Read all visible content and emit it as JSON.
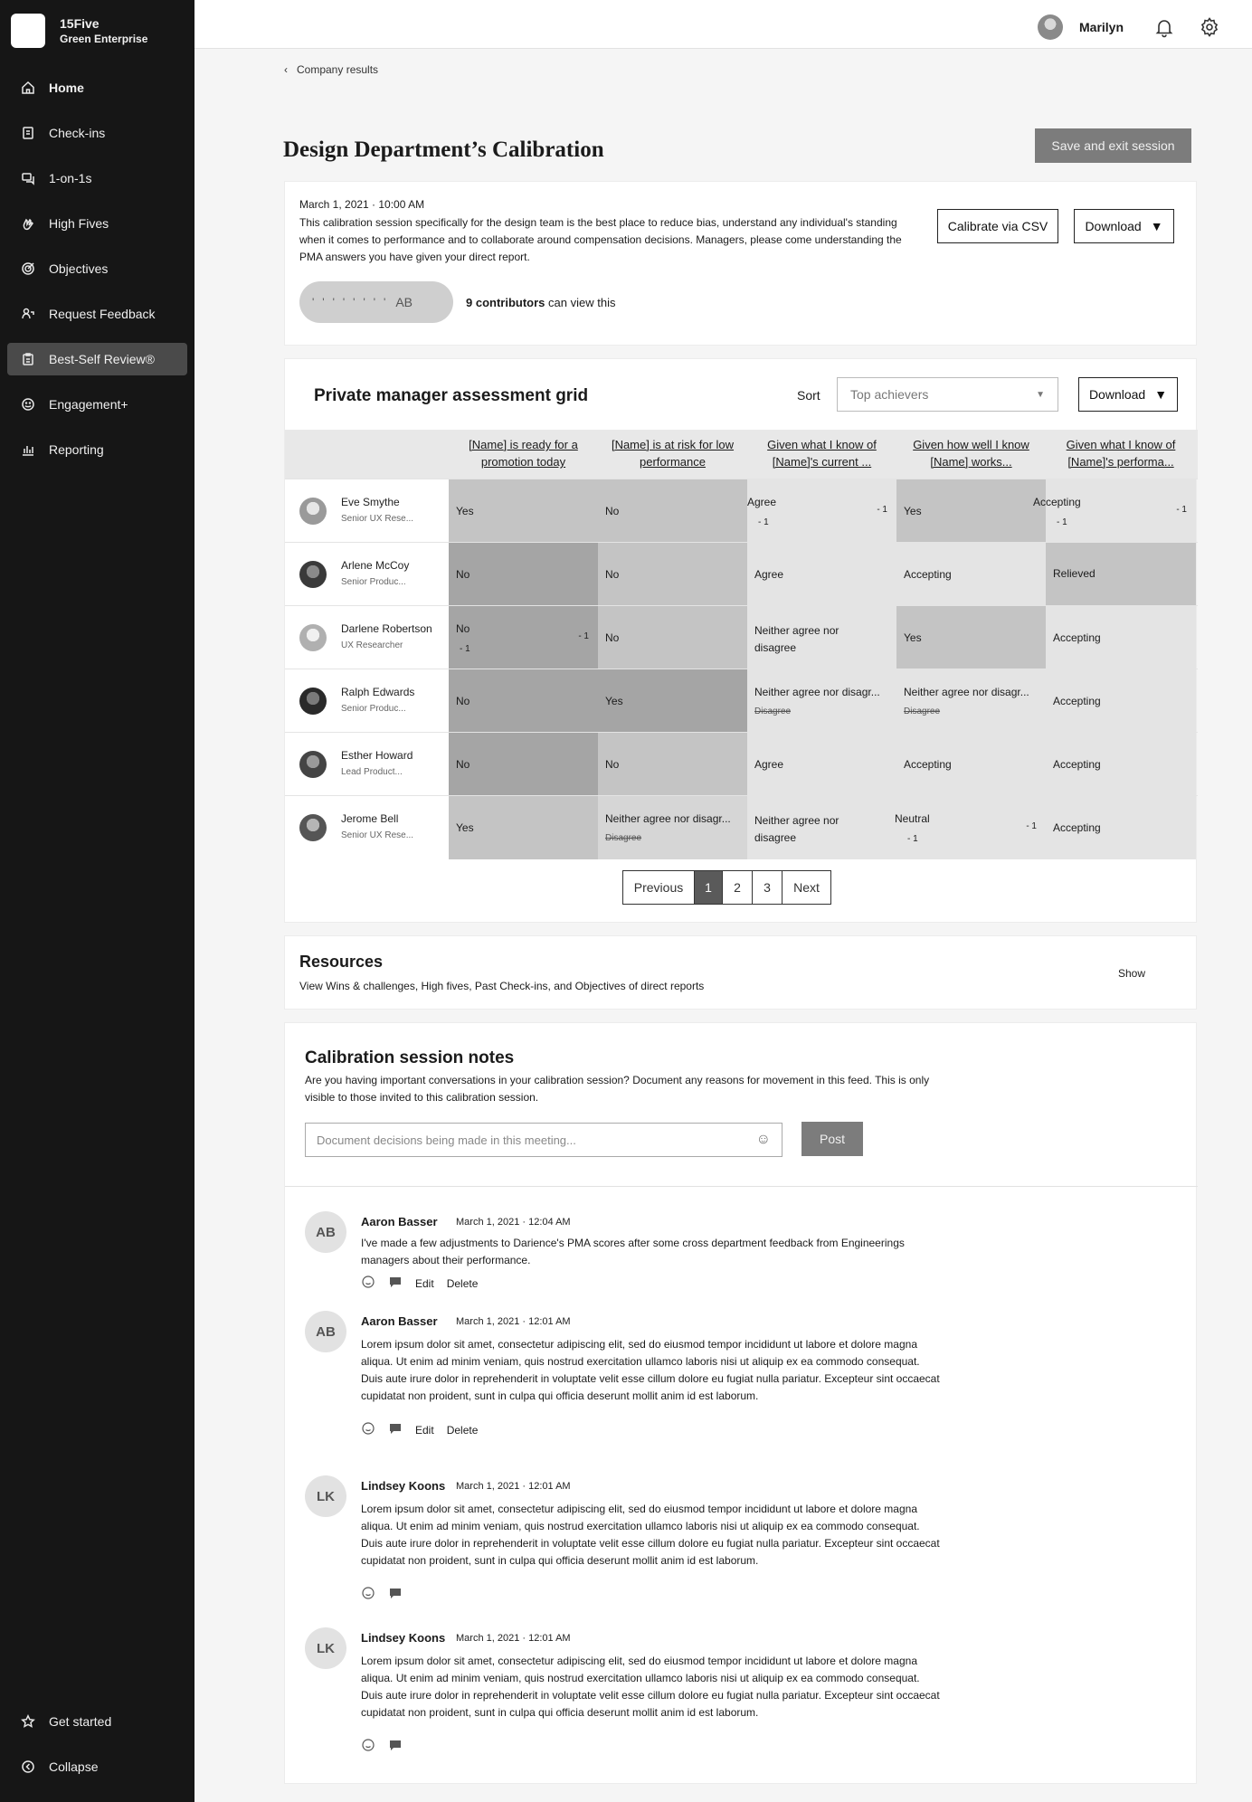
{
  "brand": {
    "name": "15Five",
    "org": "Green Enterprise"
  },
  "sidebar": {
    "items": [
      {
        "label": "Home",
        "icon": "home-icon"
      },
      {
        "label": "Check-ins",
        "icon": "checkin-icon"
      },
      {
        "label": "1-on-1s",
        "icon": "chat-icon"
      },
      {
        "label": "High Fives",
        "icon": "high-five-icon"
      },
      {
        "label": "Objectives",
        "icon": "target-icon"
      },
      {
        "label": "Request Feedback",
        "icon": "feedback-icon"
      },
      {
        "label": "Best-Self Review®",
        "icon": "review-icon"
      },
      {
        "label": "Engagement+",
        "icon": "engagement-icon"
      },
      {
        "label": "Reporting",
        "icon": "chart-icon"
      }
    ],
    "bottom": [
      {
        "label": "Get started",
        "icon": "star-icon"
      },
      {
        "label": "Collapse",
        "icon": "collapse-icon"
      }
    ]
  },
  "topbar": {
    "user": "Marilyn"
  },
  "breadcrumb": "Company results",
  "page": {
    "title": "Design Department’s Calibration",
    "save_label": "Save and exit session"
  },
  "intro": {
    "date": "March 1, 2021 · 10:00 AM",
    "description": "This calibration session specifically for the design team is the best place to reduce bias, understand any individual's standing when it comes to performance and to collaborate around compensation decisions. Managers, please come understanding the PMA answers you have given your direct report.",
    "calibrate_label": "Calibrate via CSV",
    "download_label": "Download",
    "avatar_initials": "AB",
    "contributors_count": "9 contributors",
    "contributors_text": "can view this"
  },
  "grid": {
    "title": "Private manager assessment grid",
    "sort_label": "Sort",
    "sort_value": "Top achievers",
    "download_label": "Download",
    "columns": [
      "[Name] is ready for a promotion today",
      "[Name] is at risk for low performance",
      "Given what I know of [Name]'s current ...",
      "Given how well I know [Name] works...",
      "Given what I know of [Name]'s performa..."
    ],
    "rows": [
      {
        "name": "Eve Smythe",
        "role": "Senior UX Rese...",
        "cells": [
          {
            "v": "Yes"
          },
          {
            "v": "No"
          },
          {
            "v": "Agree",
            "delta": "- 1",
            "delta2": "- 1"
          },
          {
            "v": "Yes"
          },
          {
            "v": "Accepting",
            "delta": "- 1",
            "delta2": "- 1"
          }
        ]
      },
      {
        "name": "Arlene McCoy",
        "role": "Senior Produc...",
        "cells": [
          {
            "v": "No"
          },
          {
            "v": "No"
          },
          {
            "v": "Agree"
          },
          {
            "v": "Accepting"
          },
          {
            "v": "Relieved"
          }
        ]
      },
      {
        "name": "Darlene Robertson",
        "role": "UX Researcher",
        "cells": [
          {
            "v": "No",
            "delta": "- 1",
            "delta2": "- 1"
          },
          {
            "v": "No"
          },
          {
            "v": "Neither agree nor disagree"
          },
          {
            "v": "Yes"
          },
          {
            "v": "Accepting"
          }
        ]
      },
      {
        "name": "Ralph Edwards",
        "role": "Senior Produc...",
        "cells": [
          {
            "v": "No"
          },
          {
            "v": "Yes"
          },
          {
            "v": "Neither agree nor disagr...",
            "strike": "Disagree"
          },
          {
            "v": "Neither agree nor disagr...",
            "strike": "Disagree"
          },
          {
            "v": "Accepting"
          }
        ]
      },
      {
        "name": "Esther Howard",
        "role": "Lead Product...",
        "cells": [
          {
            "v": "No"
          },
          {
            "v": "No"
          },
          {
            "v": "Agree"
          },
          {
            "v": "Accepting"
          },
          {
            "v": "Accepting"
          }
        ]
      },
      {
        "name": "Jerome Bell",
        "role": "Senior UX Rese...",
        "cells": [
          {
            "v": "Yes"
          },
          {
            "v": "Neither agree nor disagr...",
            "strike": "Disagree"
          },
          {
            "v": "Neither agree nor disagree"
          },
          {
            "v": "Neutral",
            "delta": "- 1",
            "delta2": "- 1"
          },
          {
            "v": "Accepting"
          }
        ]
      }
    ],
    "pagination": {
      "previous": "Previous",
      "pages": [
        "1",
        "2",
        "3"
      ],
      "next": "Next"
    }
  },
  "resources": {
    "title": "Resources",
    "subtitle": "View Wins & challenges, High fives, Past Check-ins, and Objectives of direct reports",
    "show_label": "Show"
  },
  "notes": {
    "title": "Calibration session notes",
    "description": "Are you having important conversations in your calibration session? Document any reasons for movement in this feed. This is only visible to those invited to this calibration session.",
    "placeholder": "Document decisions being made in this meeting...",
    "post_label": "Post",
    "comments": [
      {
        "initials": "AB",
        "author": "Aaron Basser",
        "time": "March 1, 2021 · 12:04 AM",
        "text": "I've made a few adjustments to Darience's PMA scores after some cross department feedback from Engineerings managers about their performance.",
        "edit": "Edit",
        "delete": "Delete"
      },
      {
        "initials": "AB",
        "author": "Aaron Basser",
        "time": "March 1, 2021 · 12:01 AM",
        "text": "Lorem ipsum dolor sit amet, consectetur adipiscing elit, sed do eiusmod tempor incididunt ut labore et dolore magna aliqua. Ut enim ad minim veniam, quis nostrud exercitation ullamco laboris nisi ut aliquip ex ea commodo consequat. Duis aute irure dolor in reprehenderit in voluptate velit esse cillum dolore eu fugiat nulla pariatur. Excepteur sint occaecat cupidatat non proident, sunt in culpa qui officia deserunt mollit anim id est laborum.",
        "edit": "Edit",
        "delete": "Delete"
      },
      {
        "initials": "LK",
        "author": "Lindsey Koons",
        "time": "March 1, 2021 · 12:01 AM",
        "text": "Lorem ipsum dolor sit amet, consectetur adipiscing elit, sed do eiusmod tempor incididunt ut labore et dolore magna aliqua. Ut enim ad minim veniam, quis nostrud exercitation ullamco laboris nisi ut aliquip ex ea commodo consequat. Duis aute irure dolor in reprehenderit in voluptate velit esse cillum dolore eu fugiat nulla pariatur. Excepteur sint occaecat cupidatat non proident, sunt in culpa qui officia deserunt mollit anim id est laborum."
      },
      {
        "initials": "LK",
        "author": "Lindsey Koons",
        "time": "March 1, 2021 · 12:01 AM",
        "text": "Lorem ipsum dolor sit amet, consectetur adipiscing elit, sed do eiusmod tempor incididunt ut labore et dolore magna aliqua. Ut enim ad minim veniam, quis nostrud exercitation ullamco laboris nisi ut aliquip ex ea commodo consequat. Duis aute irure dolor in reprehenderit in voluptate velit esse cillum dolore eu fugiat nulla pariatur. Excepteur sint occaecat cupidatat non proident, sunt in culpa qui officia deserunt mollit anim id est laborum."
      }
    ]
  }
}
